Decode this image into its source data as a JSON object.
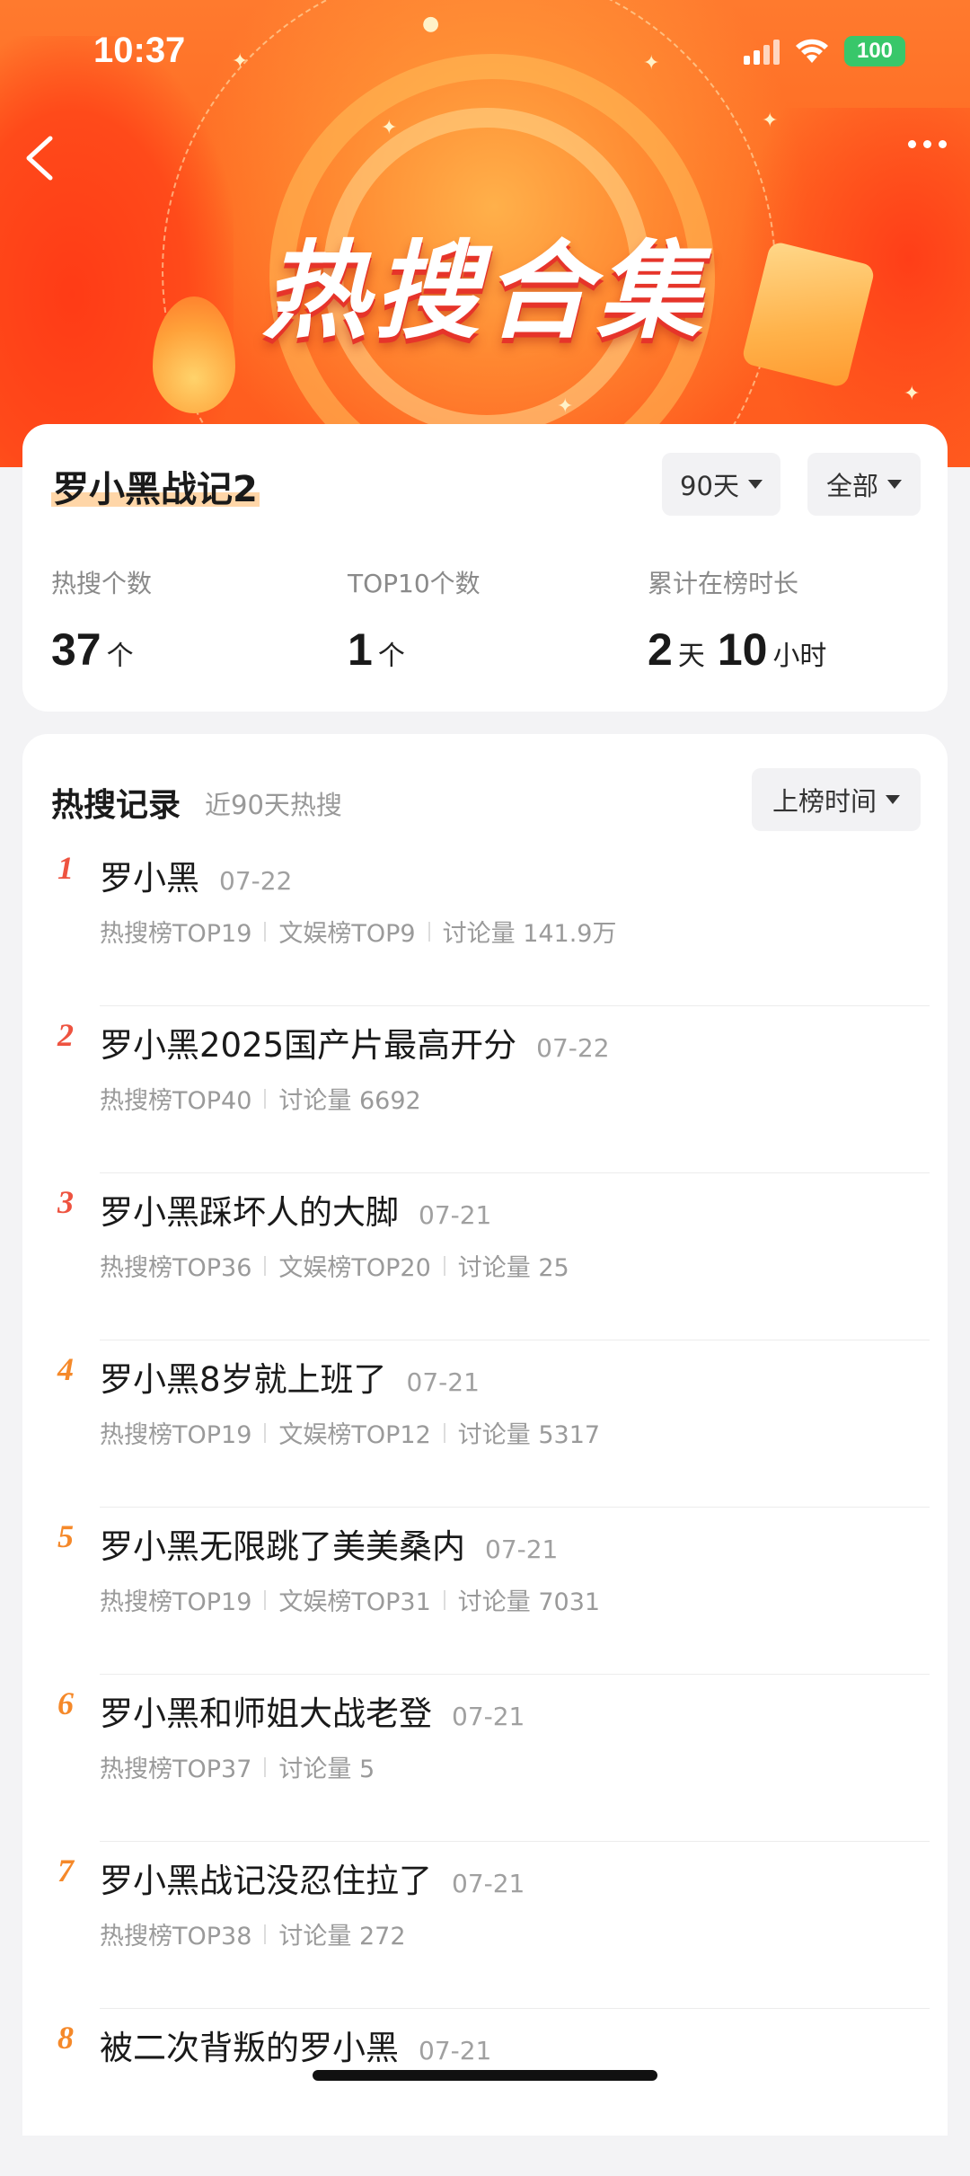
{
  "status_bar": {
    "time": "10:37",
    "battery": "100"
  },
  "banner": {
    "title": "热搜合集"
  },
  "summary": {
    "topic": "罗小黑战记2",
    "filter_days": "90天",
    "filter_scope": "全部",
    "stats": [
      {
        "label": "热搜个数",
        "value": "37",
        "unit": "个"
      },
      {
        "label": "TOP10个数",
        "value": "1",
        "unit": "个"
      },
      {
        "label": "累计在榜时长",
        "value1": "2",
        "unit1": "天",
        "value2": "10",
        "unit2": "小时"
      }
    ]
  },
  "records": {
    "title": "热搜记录",
    "subtitle": "近90天热搜",
    "sort_label": "上榜时间",
    "items": [
      {
        "rank": "1",
        "title": "罗小黑",
        "date": "07-22",
        "meta": [
          "热搜榜TOP19",
          "文娱榜TOP9",
          "讨论量 141.9万"
        ]
      },
      {
        "rank": "2",
        "title": "罗小黑2025国产片最高开分",
        "date": "07-22",
        "meta": [
          "热搜榜TOP40",
          "讨论量 6692"
        ]
      },
      {
        "rank": "3",
        "title": "罗小黑踩坏人的大脚",
        "date": "07-21",
        "meta": [
          "热搜榜TOP36",
          "文娱榜TOP20",
          "讨论量 25"
        ]
      },
      {
        "rank": "4",
        "title": "罗小黑8岁就上班了",
        "date": "07-21",
        "meta": [
          "热搜榜TOP19",
          "文娱榜TOP12",
          "讨论量 5317"
        ]
      },
      {
        "rank": "5",
        "title": "罗小黑无限跳了美美桑内",
        "date": "07-21",
        "meta": [
          "热搜榜TOP19",
          "文娱榜TOP31",
          "讨论量 7031"
        ]
      },
      {
        "rank": "6",
        "title": "罗小黑和师姐大战老登",
        "date": "07-21",
        "meta": [
          "热搜榜TOP37",
          "讨论量 5"
        ]
      },
      {
        "rank": "7",
        "title": "罗小黑战记没忍住拉了",
        "date": "07-21",
        "meta": [
          "热搜榜TOP38",
          "讨论量 272"
        ]
      },
      {
        "rank": "8",
        "title": "被二次背叛的罗小黑",
        "date": "07-21",
        "meta": []
      }
    ]
  },
  "colors": {
    "rank_top3": "#ee5340",
    "rank_rest": "#f5892a",
    "banner": "#ff6a22"
  }
}
